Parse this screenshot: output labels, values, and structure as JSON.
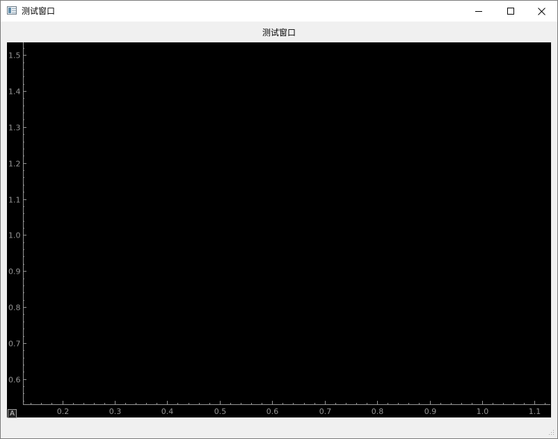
{
  "window": {
    "title": "测试窗口",
    "controls": {
      "minimize": "minimize",
      "maximize": "maximize",
      "close": "close"
    }
  },
  "plot": {
    "title": "测试窗口",
    "background": "#000000",
    "axis_color": "#969696",
    "auto_range_label": "A"
  },
  "chart_data": {
    "type": "line",
    "title": "测试窗口",
    "xlabel": "",
    "ylabel": "",
    "xlim": [
      0.125,
      1.13
    ],
    "ylim": [
      0.53,
      1.535
    ],
    "x_ticks": [
      "0.2",
      "0.3",
      "0.4",
      "0.5",
      "0.6",
      "0.7",
      "0.8",
      "0.9",
      "1.0",
      "1.1"
    ],
    "y_ticks": [
      "0.6",
      "0.7",
      "0.8",
      "0.9",
      "1.0",
      "1.1",
      "1.2",
      "1.3",
      "1.4",
      "1.5"
    ],
    "series": [],
    "grid": false
  }
}
